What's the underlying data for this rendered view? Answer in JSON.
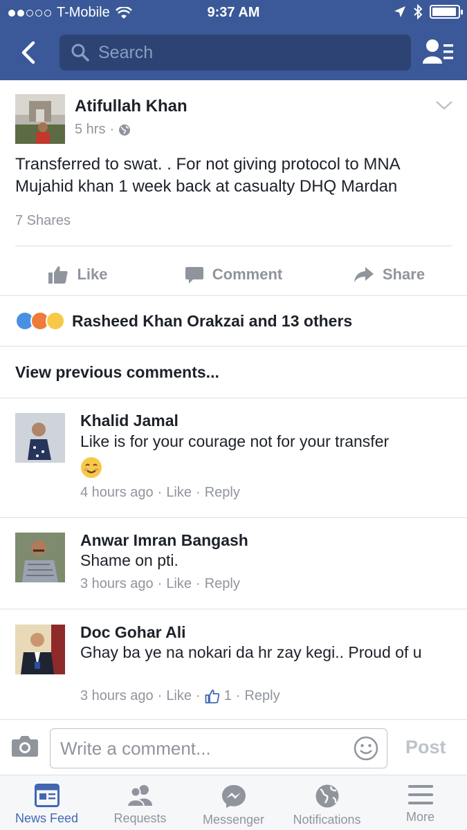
{
  "status_bar": {
    "carrier": "T-Mobile",
    "time": "9:37 AM",
    "battery_level": 0.95
  },
  "nav": {
    "search_placeholder": "Search"
  },
  "post": {
    "author": "Atifullah Khan",
    "time": "5 hrs",
    "separator": "·",
    "text": "Transferred to swat. . For not giving protocol to MNA Mujahid khan 1 week back at casualty DHQ Mardan",
    "shares": "7 Shares",
    "actions": {
      "like": "Like",
      "comment": "Comment",
      "share": "Share"
    },
    "reactions_text": "Rasheed Khan Orakzai and 13 others"
  },
  "view_previous": "View previous comments...",
  "comments": [
    {
      "name": "Khalid Jamal",
      "text": "Like is for your courage not for your transfer",
      "time": "4 hours ago",
      "like": "Like",
      "reply": "Reply",
      "dot": "·"
    },
    {
      "name": "Anwar Imran Bangash",
      "text": "Shame on pti.",
      "time": "3 hours ago",
      "like": "Like",
      "reply": "Reply",
      "dot": "·"
    },
    {
      "name": "Doc Gohar Ali",
      "text": "Ghay ba ye na nokari da hr zay kegi.. Proud of u",
      "time": "3 hours ago",
      "like": "Like",
      "like_count": "1",
      "reply": "Reply",
      "dot": "·"
    }
  ],
  "composer": {
    "placeholder": "Write a comment...",
    "post_label": "Post"
  },
  "tabs": [
    {
      "label": "News Feed",
      "icon": "news-feed-icon",
      "active": true
    },
    {
      "label": "Requests",
      "icon": "friend-requests-icon"
    },
    {
      "label": "Messenger",
      "icon": "messenger-icon"
    },
    {
      "label": "Notifications",
      "icon": "globe-icon"
    },
    {
      "label": "More",
      "icon": "menu-icon"
    }
  ],
  "colors": {
    "brand": "#3b5998",
    "active_tab": "#4267b2",
    "muted": "#90949c"
  }
}
